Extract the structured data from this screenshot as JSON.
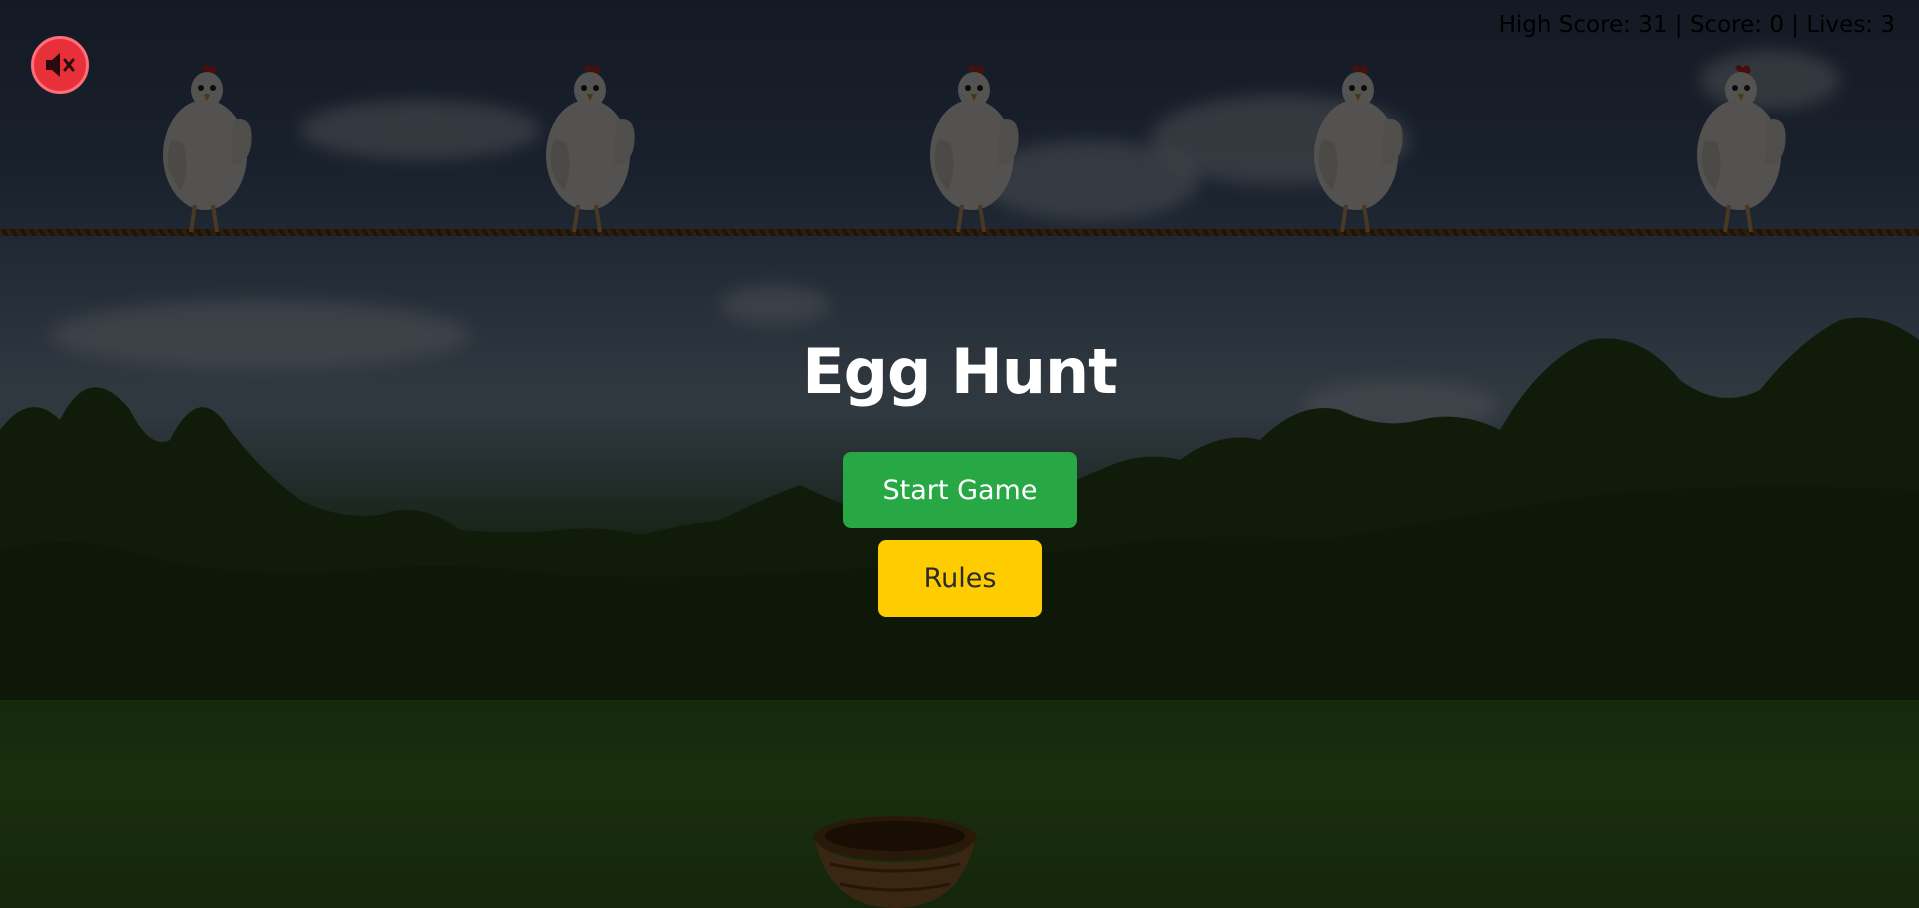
{
  "game": {
    "title": "Egg Hunt",
    "start_label": "Start Game",
    "rules_label": "Rules",
    "stats_text": "High Score: 31 | Score: 0 | Lives: 3",
    "high_score": 31,
    "score": 0,
    "lives": 3,
    "mute_icon": "speaker-muted-icon"
  },
  "scene": {
    "hen_count": 5,
    "hen_icon": "hen-icon",
    "basket_icon": "basket-icon",
    "rope": "rope"
  },
  "colors": {
    "start_button": "#28a745",
    "rules_button": "#ffcc00",
    "mute_button": "#e8303a",
    "title_text": "#ffffff"
  }
}
